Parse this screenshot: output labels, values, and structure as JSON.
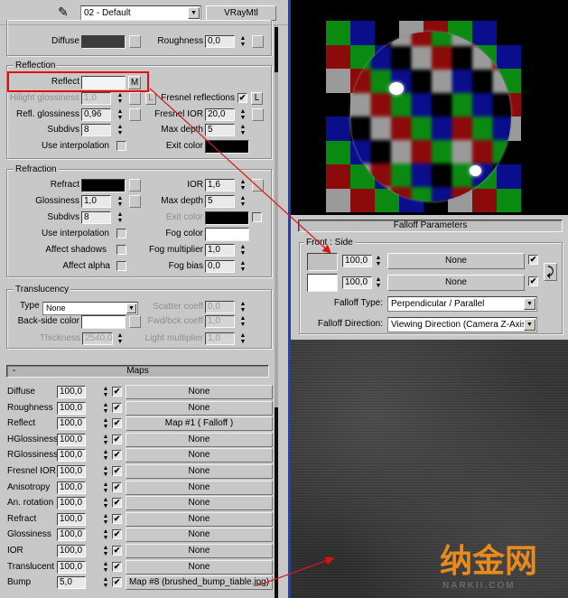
{
  "material_editor": {
    "material_name": "02 - Default",
    "material_type": "VRayMtl"
  },
  "basic": {
    "diffuse_label": "Diffuse",
    "diffuse_color": "#3c3c3c",
    "roughness_label": "Roughness",
    "roughness_value": "0,0"
  },
  "reflection": {
    "title": "Reflection",
    "reflect_label": "Reflect",
    "reflect_color": "#f4f4f4",
    "reflect_map_button": "M",
    "hilight_glossiness_label": "Hilight glossiness",
    "hilight_glossiness_value": "1,0",
    "lock_button": "L",
    "fresnel_reflections_label": "Fresnel reflections",
    "fresnel_reflections_checked": true,
    "fresnel_lock_button": "L",
    "refl_glossiness_label": "Refl. glossiness",
    "refl_glossiness_value": "0,96",
    "fresnel_ior_label": "Fresnel IOR",
    "fresnel_ior_value": "20,0",
    "subdivs_label": "Subdivs",
    "subdivs_value": "8",
    "max_depth_label": "Max depth",
    "max_depth_value": "5",
    "use_interpolation_label": "Use interpolation",
    "use_interpolation_checked": false,
    "exit_color_label": "Exit color",
    "exit_color": "#000000"
  },
  "refraction": {
    "title": "Refraction",
    "refract_label": "Refract",
    "refract_color": "#000000",
    "ior_label": "IOR",
    "ior_value": "1,6",
    "glossiness_label": "Glossiness",
    "glossiness_value": "1,0",
    "max_depth_label": "Max depth",
    "max_depth_value": "5",
    "subdivs_label": "Subdivs",
    "subdivs_value": "8",
    "exit_color_label": "Exit color",
    "exit_color": "#000000",
    "use_interpolation_label": "Use interpolation",
    "fog_color_label": "Fog color",
    "fog_color": "#ffffff",
    "affect_shadows_label": "Affect shadows",
    "fog_multiplier_label": "Fog multiplier",
    "fog_multiplier_value": "1,0",
    "affect_alpha_label": "Affect alpha",
    "fog_bias_label": "Fog bias",
    "fog_bias_value": "0,0"
  },
  "translucency": {
    "title": "Translucency",
    "type_label": "Type",
    "type_value": "None",
    "scatter_coeff_label": "Scatter coeff",
    "scatter_coeff_value": "0,0",
    "back_side_color_label": "Back-side color",
    "back_side_color": "#ffffff",
    "fwd_bck_coeff_label": "Fwd/bck coeff",
    "fwd_bck_coeff_value": "1,0",
    "thickness_label": "Thickness",
    "thickness_value": "2540,0",
    "light_multiplier_label": "Light multiplier",
    "light_multiplier_value": "1,0"
  },
  "maps": {
    "collapse_symbol": "-",
    "title": "Maps",
    "rows": [
      {
        "name": "Diffuse",
        "amount": "100,0",
        "enabled": true,
        "map": "None"
      },
      {
        "name": "Roughness",
        "amount": "100,0",
        "enabled": true,
        "map": "None"
      },
      {
        "name": "Reflect",
        "amount": "100,0",
        "enabled": true,
        "map": "Map #1  ( Falloff )"
      },
      {
        "name": "HGlossiness",
        "amount": "100,0",
        "enabled": true,
        "map": "None"
      },
      {
        "name": "RGlossiness",
        "amount": "100,0",
        "enabled": true,
        "map": "None"
      },
      {
        "name": "Fresnel IOR",
        "amount": "100,0",
        "enabled": true,
        "map": "None"
      },
      {
        "name": "Anisotropy",
        "amount": "100,0",
        "enabled": true,
        "map": "None"
      },
      {
        "name": "An. rotation",
        "amount": "100,0",
        "enabled": true,
        "map": "None"
      },
      {
        "name": "Refract",
        "amount": "100,0",
        "enabled": true,
        "map": "None"
      },
      {
        "name": "Glossiness",
        "amount": "100,0",
        "enabled": true,
        "map": "None"
      },
      {
        "name": "IOR",
        "amount": "100,0",
        "enabled": true,
        "map": "None"
      },
      {
        "name": "Translucent",
        "amount": "100,0",
        "enabled": true,
        "map": "None"
      },
      {
        "name": "Bump",
        "amount": "5,0",
        "enabled": true,
        "map": "Map #8 (brushed_bump_tiable.jpg)"
      }
    ]
  },
  "preview": {
    "checker_colors": {
      "G": "#0b8a12",
      "B": "#0a0d8c",
      "K": "#000000",
      "W": "#9a9a9a",
      "R": "#8c0a0a"
    },
    "checker_rows": [
      "GBKWRGBK",
      "RGBKWRGB",
      "WRGBKWRG",
      "KWRGBKWR",
      "BKWRGBKW",
      "GBKWRGBK",
      "RGBKWRGB",
      "WRGBKWRG"
    ]
  },
  "falloff": {
    "title": "Falloff Parameters",
    "group_title": "Front : Side",
    "front_color": "#c0c0c0",
    "front_amount": "100,0",
    "front_map": "None",
    "front_enabled": true,
    "side_color": "#ffffff",
    "side_amount": "100,0",
    "side_map": "None",
    "side_enabled": true,
    "swap_symbol": "⤸",
    "falloff_type_label": "Falloff Type:",
    "falloff_type_value": "Perpendicular / Parallel",
    "falloff_direction_label": "Falloff Direction:",
    "falloff_direction_value": "Viewing Direction (Camera Z-Axis)"
  },
  "watermark": {
    "title": "纳金网",
    "subtitle": "NARKII.COM"
  },
  "glyphs": {
    "check": "✔",
    "dropdown": "▼",
    "spin_up": "▲",
    "spin_down": "▼",
    "dropper": "✎"
  }
}
